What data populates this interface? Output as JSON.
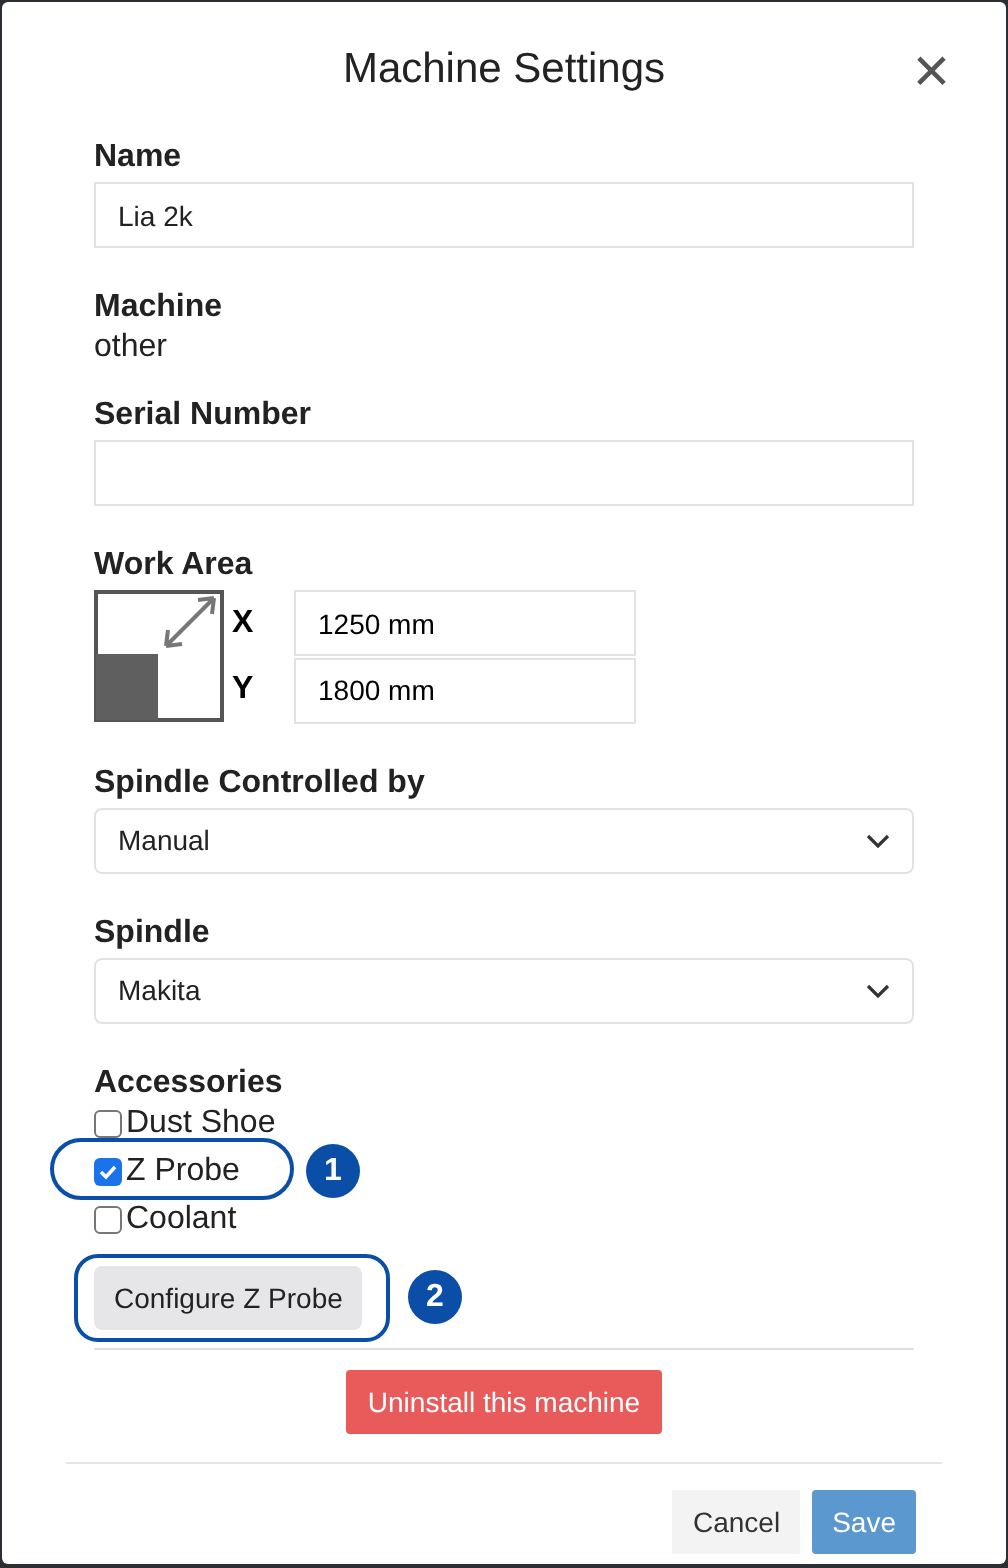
{
  "dialog": {
    "title": "Machine Settings",
    "close": "×"
  },
  "name": {
    "label": "Name",
    "value": "Lia 2k"
  },
  "machine": {
    "label": "Machine",
    "value": "other"
  },
  "serial": {
    "label": "Serial Number"
  },
  "work_area": {
    "label": "Work Area",
    "x_label": "X",
    "x_value": "1250 mm",
    "y_label": "Y",
    "y_value": "1800 mm"
  },
  "spindle_control": {
    "label": "Spindle Controlled by",
    "value": "Manual"
  },
  "spindle": {
    "label": "Spindle",
    "value": "Makita"
  },
  "accessories": {
    "label": "Accessories",
    "items": [
      {
        "label": "Dust Shoe",
        "checked": false
      },
      {
        "label": "Z Probe",
        "checked": true,
        "callout": "1"
      },
      {
        "label": "Coolant",
        "checked": false
      }
    ]
  },
  "configure_button": {
    "label": "Configure Z Probe",
    "callout": "2"
  },
  "uninstall_button": "Uninstall this machine",
  "footer": {
    "cancel": "Cancel",
    "save": "Save"
  }
}
